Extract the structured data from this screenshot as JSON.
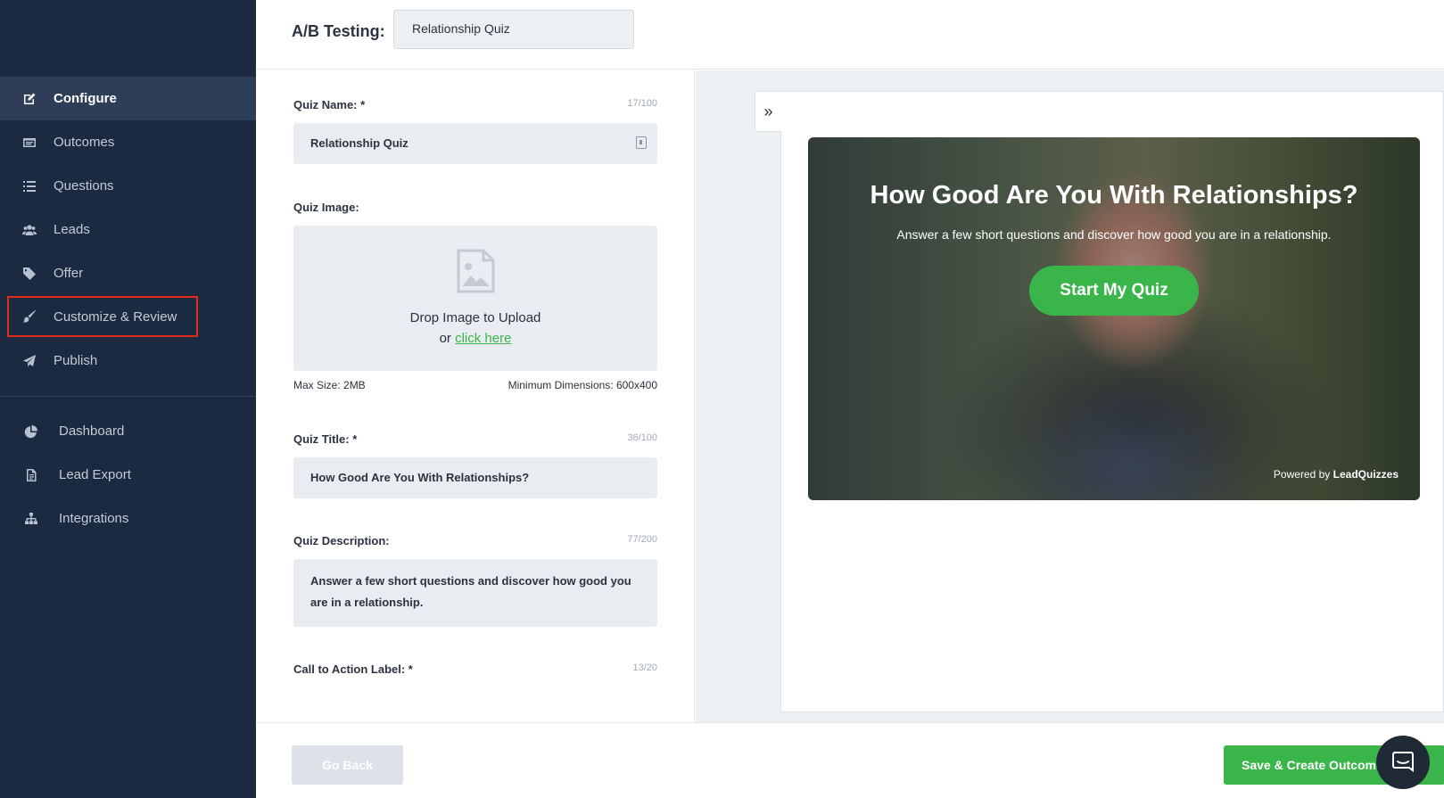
{
  "sidebar": {
    "items": [
      {
        "label": "Configure",
        "icon": "edit-icon",
        "active": true
      },
      {
        "label": "Outcomes",
        "icon": "card-icon"
      },
      {
        "label": "Questions",
        "icon": "list-icon"
      },
      {
        "label": "Leads",
        "icon": "users-icon"
      },
      {
        "label": "Offer",
        "icon": "tag-icon"
      },
      {
        "label": "Customize & Review",
        "icon": "brush-icon",
        "highlighted": true
      },
      {
        "label": "Publish",
        "icon": "send-icon"
      }
    ],
    "secondary": [
      {
        "label": "Dashboard",
        "icon": "pie-chart-icon"
      },
      {
        "label": "Lead Export",
        "icon": "document-icon"
      },
      {
        "label": "Integrations",
        "icon": "sitemap-icon"
      }
    ]
  },
  "topbar": {
    "ab_label": "A/B Testing:",
    "ab_value": "Relationship Quiz"
  },
  "form": {
    "quiz_name": {
      "label": "Quiz Name: *",
      "counter": "17/100",
      "value": "Relationship Quiz"
    },
    "quiz_image": {
      "label": "Quiz Image:",
      "drop_text": "Drop Image to Upload",
      "or_text": "or",
      "link_text": "click here",
      "max_size": "Max Size: 2MB",
      "min_dims": "Minimum Dimensions: 600x400"
    },
    "quiz_title": {
      "label": "Quiz Title: *",
      "counter": "36/100",
      "value": "How Good Are You With Relationships?"
    },
    "quiz_description": {
      "label": "Quiz Description:",
      "counter": "77/200",
      "value": "Answer a few short questions and discover how good you are in a relationship."
    },
    "cta_label": {
      "label": "Call to Action Label: *",
      "counter": "13/20"
    }
  },
  "preview": {
    "collapse_glyph": "»",
    "title": "How Good Are You With Relationships?",
    "description": "Answer a few short questions and discover how good you are in a relationship.",
    "cta": "Start My Quiz",
    "powered_prefix": "Powered by",
    "powered_brand": "LeadQuizzes"
  },
  "footer": {
    "back_label": "Go Back",
    "save_label": "Save & Create Outcomes"
  },
  "colors": {
    "sidebar_bg": "#1c2a41",
    "accent_green": "#39b54a",
    "highlight_red": "#e02b1c"
  }
}
